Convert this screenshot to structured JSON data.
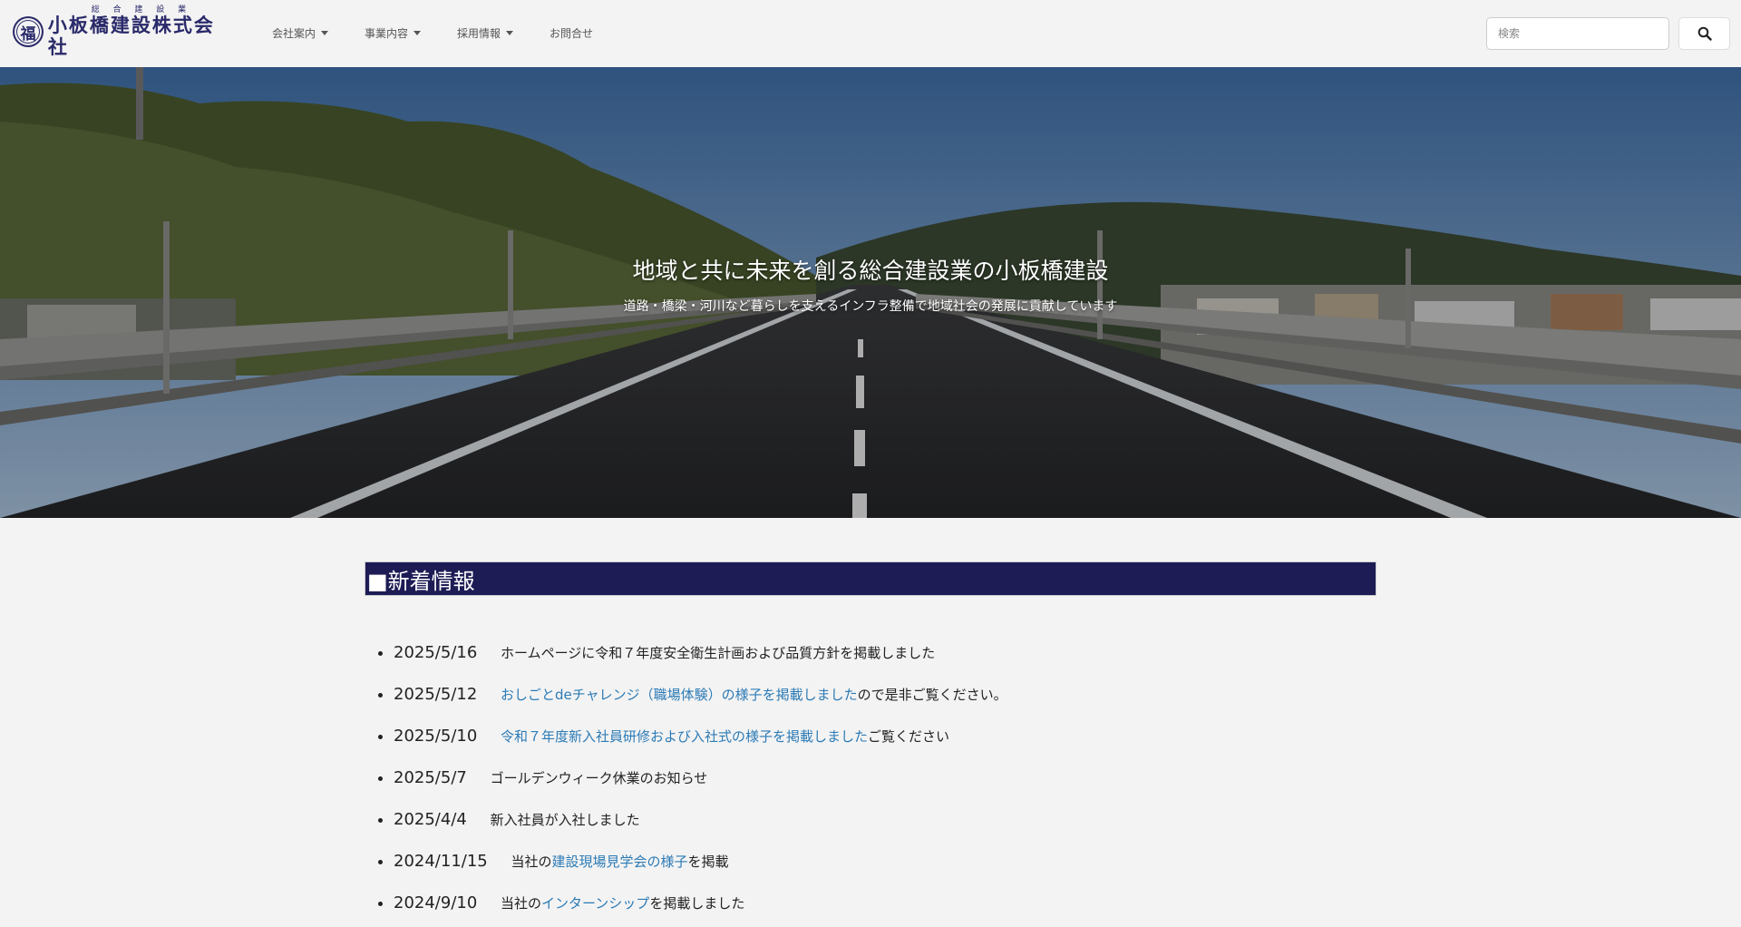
{
  "logo": {
    "mark": "福",
    "small": "総 合 建 設 業",
    "main": "小板橋建設株式会社"
  },
  "nav": {
    "items": [
      {
        "label": "会社案内",
        "dropdown": true
      },
      {
        "label": "事業内容",
        "dropdown": true
      },
      {
        "label": "採用情報",
        "dropdown": true
      },
      {
        "label": "お問合せ",
        "dropdown": false
      }
    ]
  },
  "search": {
    "placeholder": "検索",
    "button_icon": "search-icon"
  },
  "hero": {
    "title": "地域と共に未来を創る総合建設業の小板橋建設",
    "subtitle": "道路・橋梁・河川など暮らしを支えるインフラ整備で地域社会の発展に貢献しています"
  },
  "news": {
    "heading": "■新着情報",
    "items": [
      {
        "date": "2025/5/16",
        "pre": "",
        "link": "",
        "post": "ホームページに令和７年度安全衛生計画および品質方針を掲載しました"
      },
      {
        "date": "2025/5/12",
        "pre": "",
        "link": "おしごとdeチャレンジ（職場体験）の様子を掲載しました",
        "post": "ので是非ご覧ください。"
      },
      {
        "date": "2025/5/10",
        "pre": "",
        "link": "令和７年度新入社員研修および入社式の様子を掲載しました",
        "post": "ご覧ください"
      },
      {
        "date": "2025/5/7",
        "pre": "",
        "link": "",
        "post": "ゴールデンウィーク休業のお知らせ"
      },
      {
        "date": "2025/4/4",
        "pre": "",
        "link": "",
        "post": "新入社員が入社しました"
      },
      {
        "date": "2024/11/15",
        "pre": "当社の",
        "link": "建設現場見学会の様子",
        "post": "を掲載"
      },
      {
        "date": "2024/9/10",
        "pre": "当社の",
        "link": "インターンシップ",
        "post": "を掲載しました"
      }
    ]
  },
  "colors": {
    "nav_bg": "#f3f3f3",
    "news_header_bg": "#1e1c55",
    "link": "#2c7bb6",
    "logo": "#2a2a6a"
  }
}
